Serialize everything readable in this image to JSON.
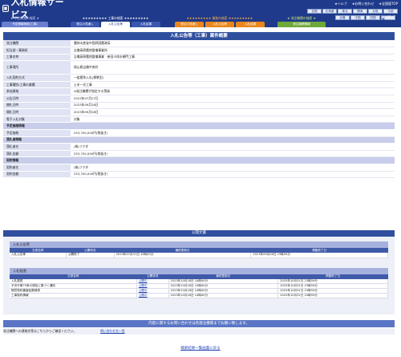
{
  "header": {
    "logo_icon": "▣",
    "title": "入札情報サービス",
    "links": [
      "★ヘルプ",
      "★お問い合わせ",
      "★全国版TOP"
    ],
    "pref_row1": [
      "全国",
      "北海道",
      "東北",
      "関東",
      "北陸",
      "中部",
      "近畿",
      "中国",
      "四国",
      "九州・沖縄"
    ],
    "pref_row2": [
      "近畿",
      "中国",
      "四国",
      "九州・沖縄"
    ]
  },
  "search_groups": [
    {
      "title": "★ 予定情報の検索 ★",
      "title_color": "#c8d0ff",
      "tab_color": "#6a7fd0",
      "tabs": [
        "予定情報検索(工事)"
      ]
    },
    {
      "title": "★★★★★★★★★ 工事の検索 ★★★★★★★★★",
      "title_color": "#ffffff",
      "tab_color": "#3b57b0",
      "tabs": [
        "発注の見通し",
        "入札公告等",
        "入札結果"
      ]
    },
    {
      "title": "★★★★★★★★★ 業務の検索 ★★★★★★★★★",
      "title_color": "#ffb347",
      "tab_color": "#e8871c",
      "tabs": [
        "発注の見通し",
        "入札公告等",
        "入札結果"
      ]
    },
    {
      "title": "★ 発注機関の検索 ★",
      "title_color": "#c6e27a",
      "tab_color": "#6fa83a",
      "tabs": [
        "発注機関情報"
      ]
    }
  ],
  "detail": {
    "caption": "入札公告等（工事）案件概要",
    "rows": [
      {
        "type": "row",
        "label": "発注機関",
        "value": "農林水産省中国四国農政局"
      },
      {
        "type": "row",
        "label": "担当部・事務所",
        "value": "吉備高原農地整備事業所"
      },
      {
        "type": "row",
        "label": "工事名称",
        "value": "吉備高原農地整備事業　新田川排水樋門工事"
      },
      {
        "type": "tall",
        "label": "工事場所",
        "value": "岡山県吉備中央町"
      },
      {
        "type": "row",
        "label": "入札契約方式",
        "value": "一般競争入札(標準型)"
      },
      {
        "type": "row",
        "label": "工事種別/工事の業種",
        "value": "土木一式工事"
      },
      {
        "type": "row",
        "label": "参加資格",
        "value": "※発注機関が指定する等級",
        "note": true
      },
      {
        "type": "row",
        "label": "公告日時",
        "value": "2023年07月27日"
      },
      {
        "type": "row",
        "label": "開札日時",
        "value": "2023年09月28日"
      },
      {
        "type": "row",
        "label": "開札日時",
        "value": "2023年09月28日"
      },
      {
        "type": "row",
        "label": "電子入札対象",
        "value": "対象"
      },
      {
        "type": "sec",
        "label": "予定価格情報"
      },
      {
        "type": "row",
        "label": "予定価格",
        "value": "253,700,000円(税抜き)"
      },
      {
        "type": "sec",
        "label": "落札者情報"
      },
      {
        "type": "row",
        "label": "落札者名",
        "value": "(株)フクダ"
      },
      {
        "type": "row",
        "label": "落札金額",
        "value": "253,700,000円(税抜き)"
      },
      {
        "type": "sec",
        "label": "契約情報"
      },
      {
        "type": "row",
        "label": "契約者名",
        "value": "(株)フクダ"
      },
      {
        "type": "row",
        "label": "契約金額",
        "value": "253,700,000円(税抜き)"
      }
    ]
  },
  "docs": {
    "caption": "公開文書",
    "koukoku": {
      "title": "入札公告等",
      "headers": [
        "文書名称",
        "公開状況",
        "最終更新日",
        "掲載終了日"
      ],
      "rows": [
        [
          "入札公告等",
          "公開終了",
          "2023年07月31日 10時00分",
          "2023年09月28日 23時59分"
        ]
      ]
    },
    "kekka": {
      "title": "入札経過",
      "headers": [
        "文書名称",
        "公開状況",
        "最終更新日",
        "掲載終了日"
      ],
      "rows": [
        [
          "入札調書",
          "公開中",
          "2023年10月18日 14時00分",
          "2025年10月31日 23時59分"
        ],
        [
          "予決令第79条の規定に基づく通知",
          "公開中",
          "2023年10月18日 14時00分",
          "2025年10月31日 23時59分"
        ],
        [
          "随意契約審査結果調書",
          "公開中",
          "2023年10月18日 14時00分",
          "2025年10月31日 23時59分"
        ],
        [
          "工事契約情報",
          "公開中",
          "2023年10月18日 14時00分",
          "2025年10月31日 23時59分"
        ]
      ]
    }
  },
  "footer": {
    "bar_text": "内容に関するお問い合わせは各発注機関までお願い致します。",
    "row_text": "発注機関への連絡先等はこちらからご確認ください。",
    "row_link": "問い合わせ先一覧",
    "back_link": "検索結果一覧画面に戻る"
  }
}
